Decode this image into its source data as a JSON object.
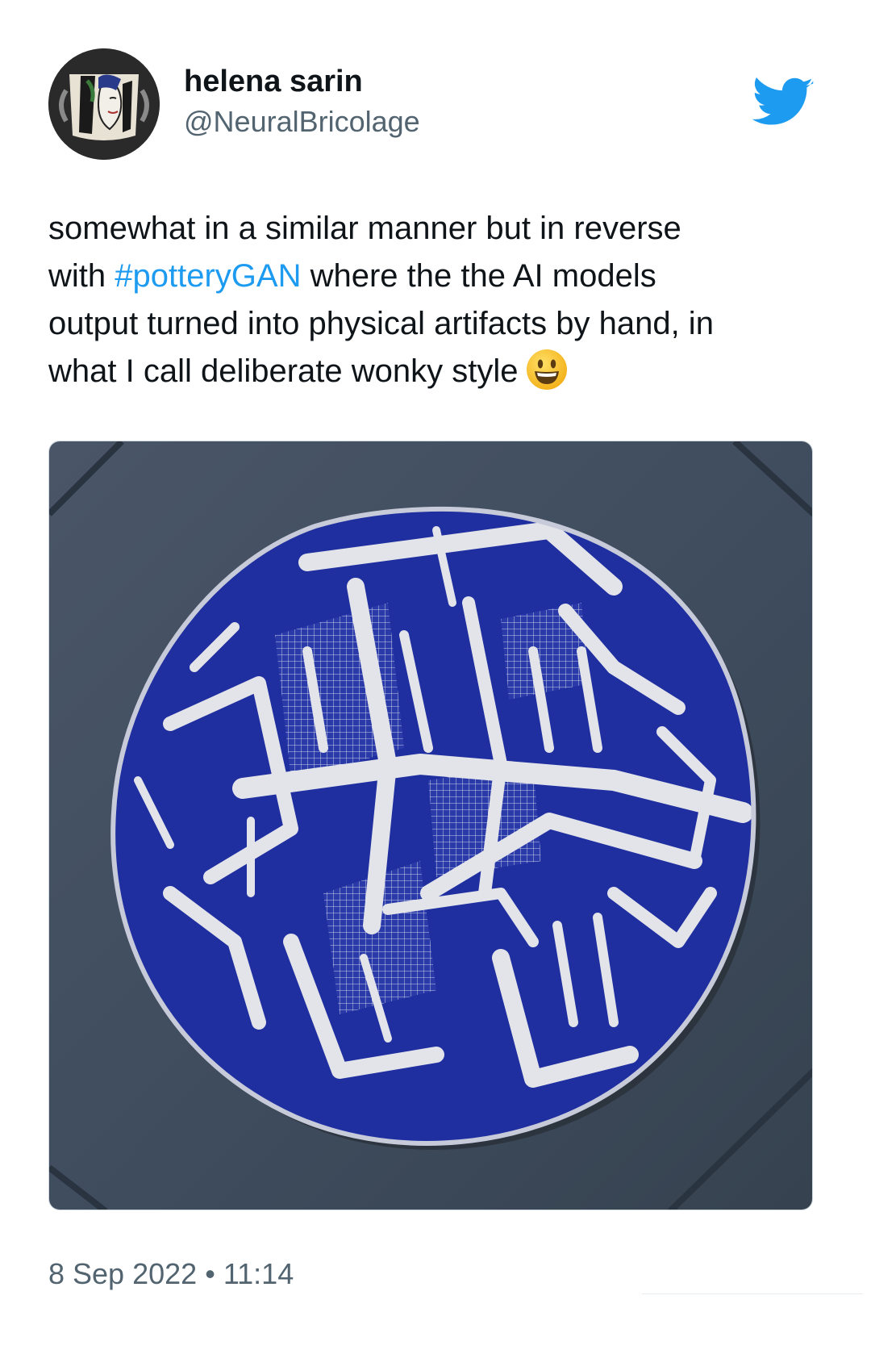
{
  "author": {
    "display_name": "helena sarin",
    "handle": "@NeuralBricolage",
    "avatar_icon": "avatar-mug-portrait"
  },
  "brand": {
    "icon": "twitter-bird-icon",
    "color": "#1d9bf0"
  },
  "tweet": {
    "line1": "somewhat in a similar manner but in reverse",
    "line2_pre": "with ",
    "hashtag": "#potteryGAN",
    "line2_post": " where the the AI models",
    "line3": "output turned into physical artifacts by hand, in",
    "line4": "what I call deliberate wonky style",
    "emoji": "smiling-face-emoji",
    "hashtag_color": "#1d9bf0"
  },
  "media": {
    "subject": "pottery-plate-photo",
    "glaze_color": "#1f2fa0",
    "slate_color": "#3f4d5f"
  },
  "meta": {
    "date": "8 Sep 2022",
    "separator": "•",
    "time": "11:14"
  }
}
